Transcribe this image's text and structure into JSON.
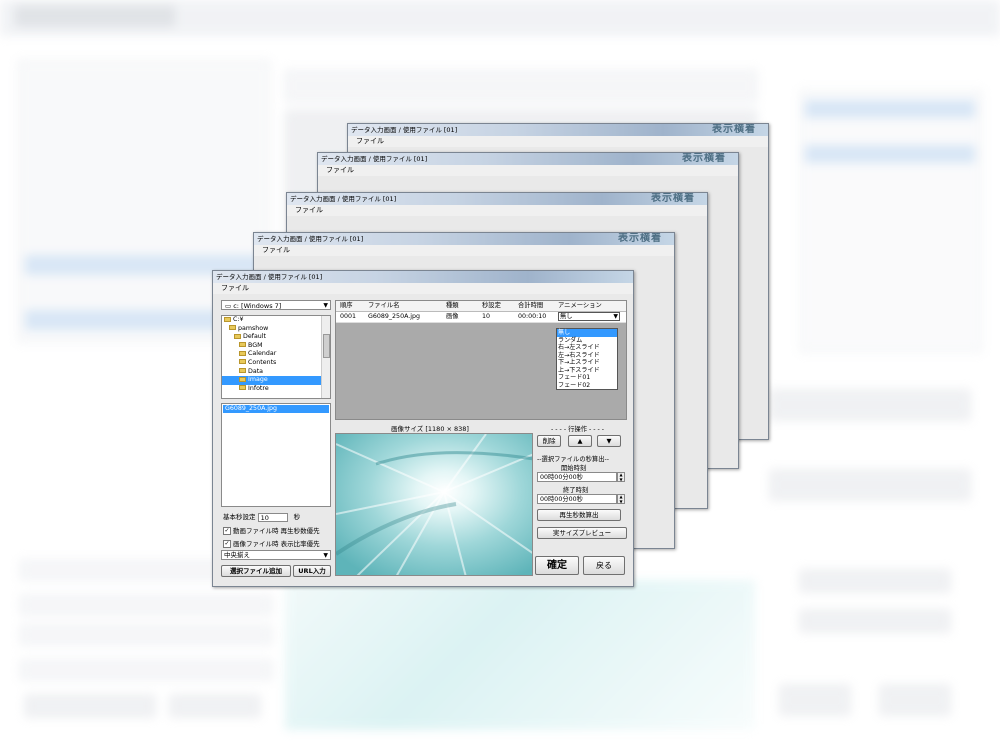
{
  "dialog": {
    "title": "データ入力画面 / 使用ファイル [01]",
    "logo_text": "表示横着",
    "menu_file": "ファイル",
    "drive": "c: [Windows 7]",
    "tree": [
      {
        "label": "C:¥",
        "indent": 0,
        "selected": false
      },
      {
        "label": "pamshow",
        "indent": 1,
        "selected": false
      },
      {
        "label": "Default",
        "indent": 2,
        "selected": false
      },
      {
        "label": "BGM",
        "indent": 3,
        "selected": false
      },
      {
        "label": "Calendar",
        "indent": 3,
        "selected": false
      },
      {
        "label": "Contents",
        "indent": 3,
        "selected": false
      },
      {
        "label": "Data",
        "indent": 3,
        "selected": false
      },
      {
        "label": "Image",
        "indent": 3,
        "selected": true
      },
      {
        "label": "Infotre",
        "indent": 3,
        "selected": false
      }
    ],
    "files": [
      "G6089_250A.jpg"
    ],
    "basic_seconds_label": "基本秒設定",
    "basic_seconds_value": "10",
    "seconds_unit": "秒",
    "check1": "動画ファイル時 再生秒数優先",
    "check2": "画像ファイル時 表示比率優先",
    "align_value": "中央揃え",
    "add_file_button": "選択ファイル追加",
    "url_button": "URL入力",
    "grid_headers": [
      "順序",
      "ファイル名",
      "種類",
      "秒設定",
      "合計時間",
      "アニメーション"
    ],
    "grid_rows": [
      {
        "order": "0001",
        "filename": "G6089_250A.jpg",
        "type": "画像",
        "seconds": "10",
        "total": "00:00:10",
        "animation": "無し"
      }
    ],
    "animation_options": [
      "無し",
      "ランダム",
      "右→左スライド",
      "左→右スライド",
      "下→上スライド",
      "上→下スライド",
      "フェード01",
      "フェード02"
    ],
    "image_size_label": "画像サイズ [1180 × 838]",
    "row_ops_label": "- - - - 行操作 - - - -",
    "delete_button": "削除",
    "up_symbol": "▲",
    "down_symbol": "▼",
    "calc_section_label": "--選択ファイルの秒算出--",
    "start_time_label": "開始時刻",
    "start_time_value": "00時00分00秒",
    "end_time_label": "終了時刻",
    "end_time_value": "00時00分00秒",
    "calc_button": "再生秒数算出",
    "preview_button": "実サイズプレビュー",
    "ok_button": "確定",
    "back_button": "戻る"
  },
  "colors": {
    "selection": "#3399ff",
    "title_gradient_end": "#9fb3cb",
    "grid_bg": "#aaaaaa"
  }
}
